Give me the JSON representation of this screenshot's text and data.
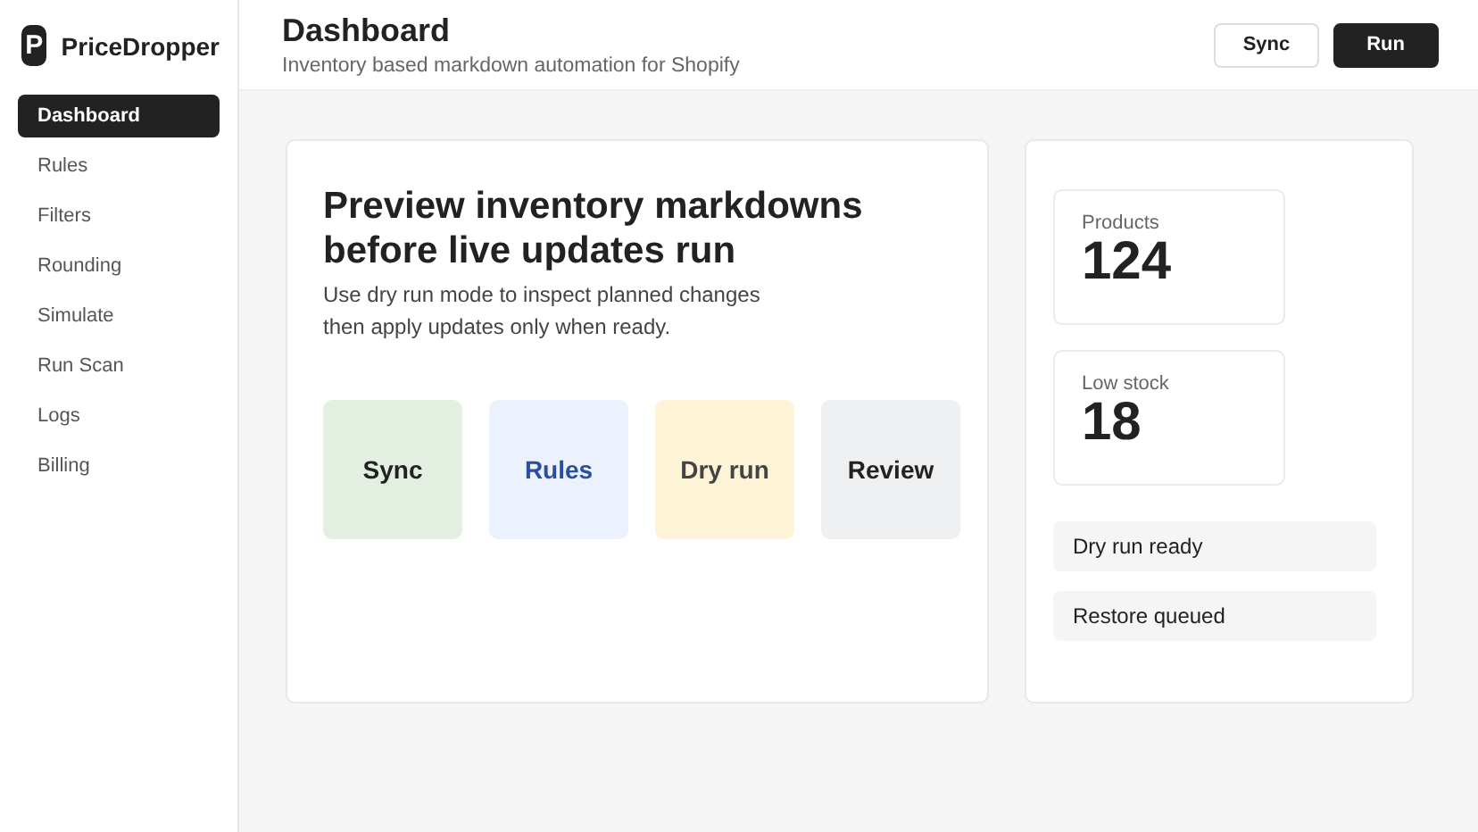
{
  "brand": {
    "logo": "P",
    "name": "PriceDropper"
  },
  "nav": [
    {
      "label": "Dashboard",
      "selected": true
    },
    {
      "label": "Rules",
      "selected": false
    },
    {
      "label": "Filters",
      "selected": false
    },
    {
      "label": "Rounding",
      "selected": false
    },
    {
      "label": "Simulate",
      "selected": false
    },
    {
      "label": "Run Scan",
      "selected": false
    },
    {
      "label": "Logs",
      "selected": false
    },
    {
      "label": "Billing",
      "selected": false
    }
  ],
  "header": {
    "title": "Dashboard",
    "subtitle": "Inventory based markdown automation for Shopify",
    "buttons": [
      {
        "label": "Sync",
        "kind": "secondary"
      },
      {
        "label": "Run",
        "kind": "primary"
      }
    ]
  },
  "hero": {
    "title": "Preview inventory markdowns before live updates run",
    "description": "Use dry run mode to inspect planned changes then apply updates only when ready."
  },
  "steps": [
    {
      "label": "Sync",
      "color": "#e3efe0",
      "kind": "plain"
    },
    {
      "label": "Rules",
      "color": "#ecf2fd",
      "kind": "accent"
    },
    {
      "label": "Dry run",
      "color": "#fdf4d8",
      "kind": "muted"
    },
    {
      "label": "Review",
      "color": "#eff0f2",
      "kind": "plain"
    }
  ],
  "stats": [
    {
      "label": "Products",
      "value": "124"
    },
    {
      "label": "Low stock",
      "value": "18"
    }
  ],
  "statuses": [
    "Dry run ready",
    "Restore queued"
  ]
}
